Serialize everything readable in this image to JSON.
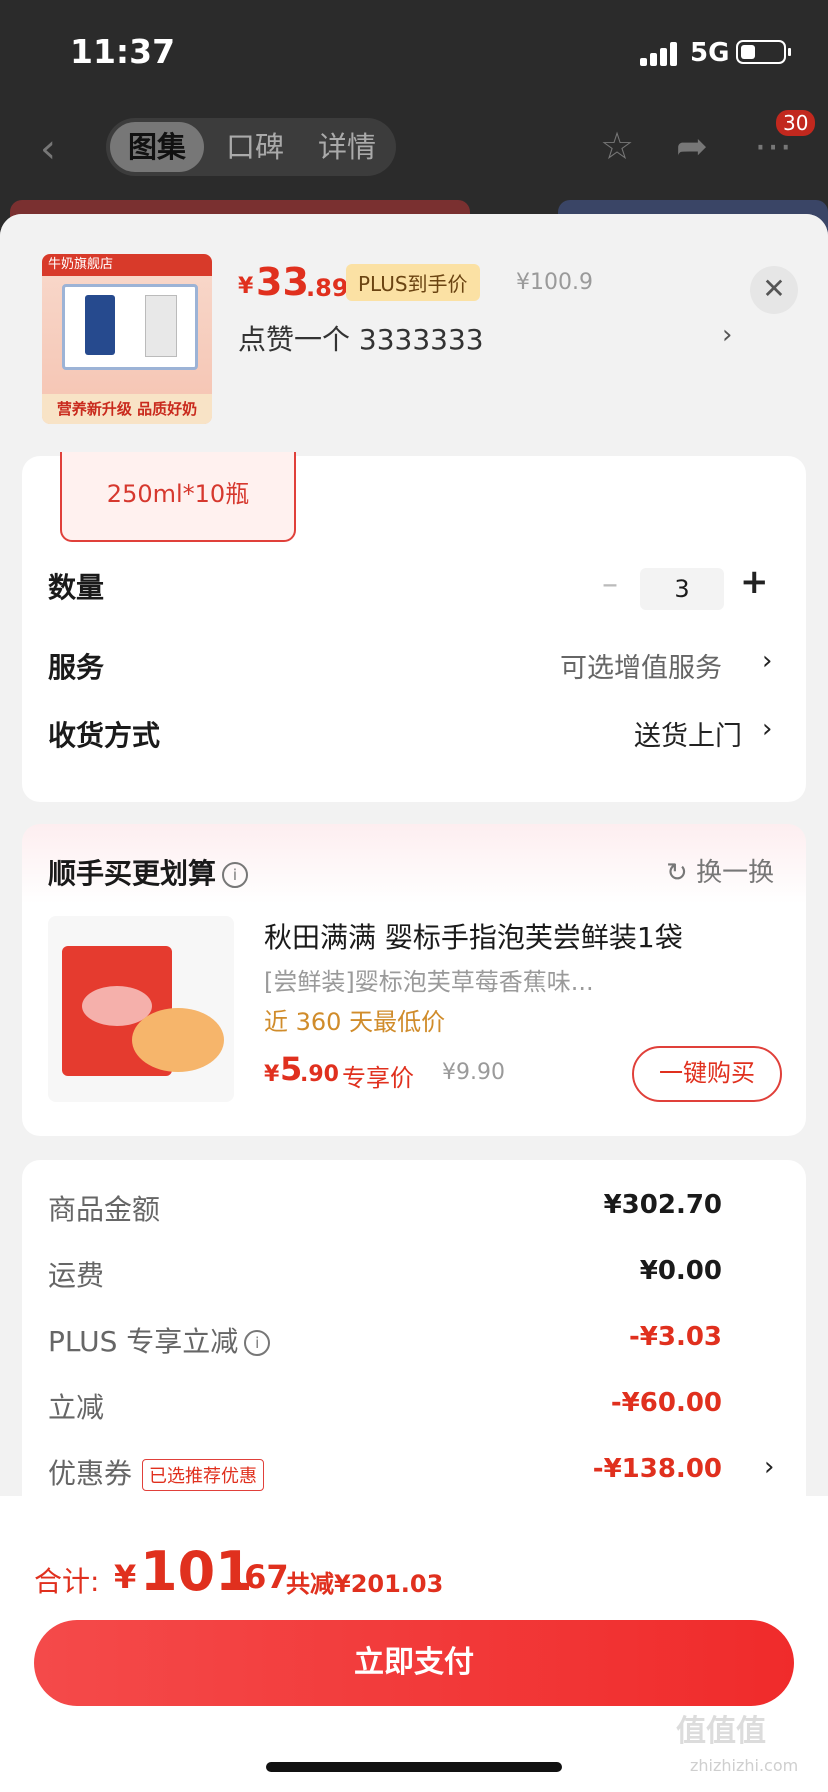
{
  "status": {
    "time": "11:37",
    "network": "5G"
  },
  "nav": {
    "tabs": [
      "图集",
      "口碑",
      "详情"
    ],
    "cart_count": "30"
  },
  "product": {
    "thumb_brand": "牛奶旗舰店",
    "thumb_slogan": "营养新升级 品质好奶",
    "currency": "¥",
    "price_int": "33",
    "price_dec": ".89",
    "plus_tag": "PLUS到手价",
    "orig_price": "¥100.9",
    "like_text": "点赞一个  3333333"
  },
  "spec": {
    "selected": "250ml*10瓶"
  },
  "options": {
    "qty_label": "数量",
    "qty_value": "3",
    "service_label": "服务",
    "service_value": "可选增值服务",
    "delivery_label": "收货方式",
    "delivery_value": "送货上门"
  },
  "recommend": {
    "title": "顺手买更划算",
    "swap": "换一换",
    "name": "秋田满满 婴标手指泡芙尝鲜装1袋",
    "subtitle": "[尝鲜装]婴标泡芙草莓香蕉味...",
    "lowest": "近 360 天最低价",
    "price_int": "5",
    "price_dec": ".90",
    "price_tag": "专享价",
    "orig_price": "¥9.90",
    "buy_label": "一键购买"
  },
  "summary": [
    {
      "label": "商品金额",
      "value": "¥302.70",
      "red": false
    },
    {
      "label": "运费",
      "value": "¥0.00",
      "red": false
    },
    {
      "label": "PLUS 专享立减",
      "value": "-¥3.03",
      "red": true
    },
    {
      "label": "立减",
      "value": "-¥60.00",
      "red": true
    },
    {
      "label": "优惠券",
      "value": "-¥138.00",
      "red": true,
      "tag": "已选推荐优惠"
    }
  ],
  "footer": {
    "total_label": "合计:",
    "currency": "¥",
    "total_int": "101",
    "total_dec": ".67",
    "saved": "共减¥201.03",
    "pay_label": "立即支付",
    "watermark": "值值值",
    "watermark_url": "zhizhizhi.com"
  },
  "colors": {
    "accent": "#e0301e",
    "plus_bg": "#fbe1a4"
  }
}
